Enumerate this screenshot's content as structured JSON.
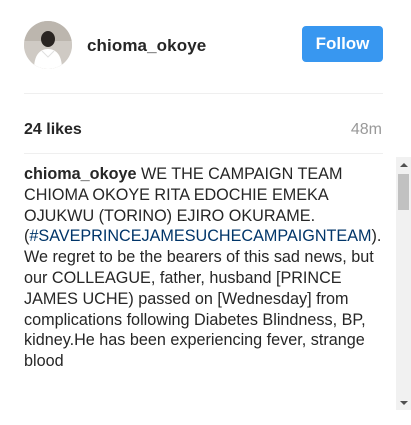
{
  "post": {
    "username": "chioma_okoye",
    "follow_label": "Follow",
    "likes": "24 likes",
    "time": "48m",
    "caption": {
      "author": "chioma_okoye",
      "text_before_tag": " WE THE CAMPAIGN TEAM CHIOMA OKOYE RITA EDOCHIE EMEKA OJUKWU (TORINO) EJIRO OKURAME. (",
      "hashtag": "#SAVEPRINCEJAMESUCHECAMPAIGNTEAM",
      "text_after_tag": "). We regret to be the bearers of this sad news, but our COLLEAGUE, father, husband [PRINCE JAMES UCHE) passed on [Wednesday] from complications following Diabetes Blindness, BP, kidney.He has been experiencing fever, strange blood"
    }
  },
  "colors": {
    "follow_button": "#3897f0",
    "hashtag": "#003569",
    "time": "#999999"
  },
  "icons": {
    "avatar": "profile-photo-avatar",
    "scroll_up": "arrow-up-icon",
    "scroll_down": "arrow-down-icon"
  }
}
